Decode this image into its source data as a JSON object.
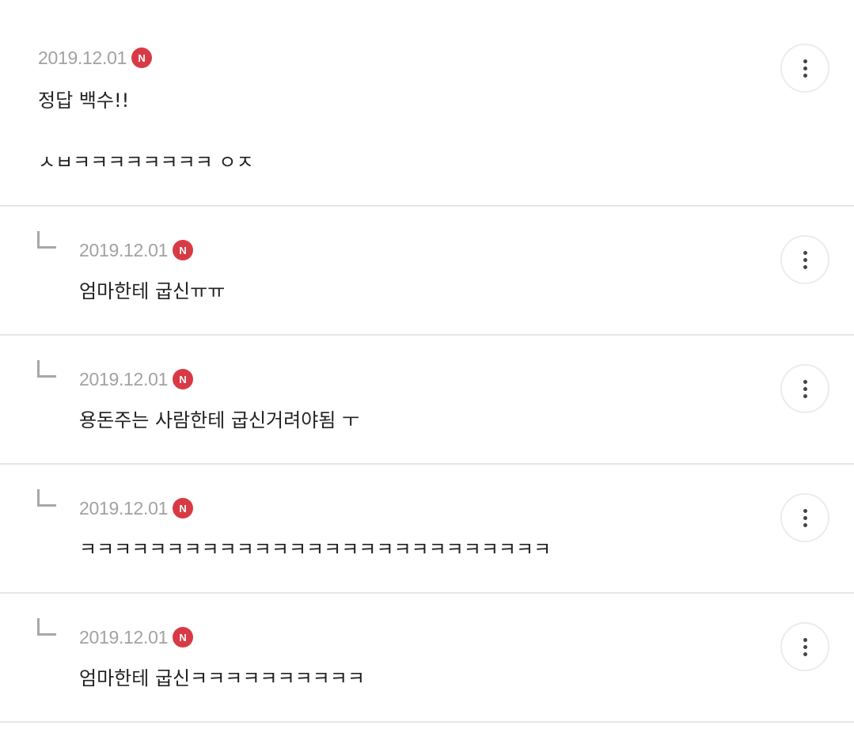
{
  "comments": [
    {
      "date": "2019.12.01",
      "badge": "N",
      "lines": [
        "정답 백수!!",
        "ㅅㅂㅋㅋㅋㅋㅋㅋㅋㅋ ㅇㅈ"
      ],
      "more_icon": "more-vertical-icon"
    }
  ],
  "replies": [
    {
      "date": "2019.12.01",
      "badge": "N",
      "text": "엄마한테 굽신ㅠㅠ",
      "reply_icon": "reply-arrow-icon",
      "more_icon": "more-vertical-icon"
    },
    {
      "date": "2019.12.01",
      "badge": "N",
      "text": "용돈주는 사람한테 굽신거려야됨 ㅜ",
      "reply_icon": "reply-arrow-icon",
      "more_icon": "more-vertical-icon"
    },
    {
      "date": "2019.12.01",
      "badge": "N",
      "text": "ㅋㅋㅋㅋㅋㅋㅋㅋㅋㅋㅋㅋㅋㅋㅋㅋㅋㅋㅋㅋㅋㅋㅋㅋㅋㅋㅋ",
      "reply_icon": "reply-arrow-icon",
      "more_icon": "more-vertical-icon"
    },
    {
      "date": "2019.12.01",
      "badge": "N",
      "text": "엄마한테 굽신ㅋㅋㅋㅋㅋㅋㅋㅋㅋㅋ",
      "reply_icon": "reply-arrow-icon",
      "more_icon": "more-vertical-icon"
    }
  ],
  "colors": {
    "badge": "#d83a45",
    "date": "#a2a2a2",
    "divider": "#e6e6e6"
  }
}
